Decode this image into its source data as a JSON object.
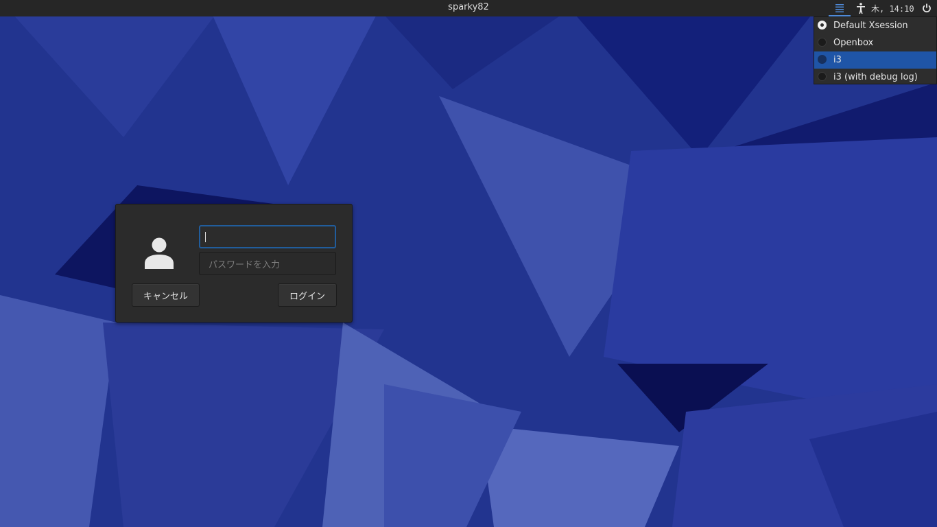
{
  "top_panel": {
    "hostname": "sparky82",
    "clock": "木, 14:10",
    "icons": [
      "session-list-icon",
      "accessibility-icon",
      "power-icon"
    ]
  },
  "session_menu": {
    "items": [
      {
        "label": "Default Xsession",
        "selected": true
      },
      {
        "label": "Openbox",
        "selected": false
      },
      {
        "label": "i3",
        "selected": false,
        "highlighted": true
      },
      {
        "label": "i3 (with debug log)",
        "selected": false
      }
    ]
  },
  "login": {
    "username_value": "",
    "password_placeholder": "パスワードを入力",
    "cancel_label": "キャンセル",
    "login_label": "ログイン"
  },
  "colors": {
    "accent": "#1f55a7",
    "panel": "#262626",
    "wallpaper_base": "#22348f"
  }
}
